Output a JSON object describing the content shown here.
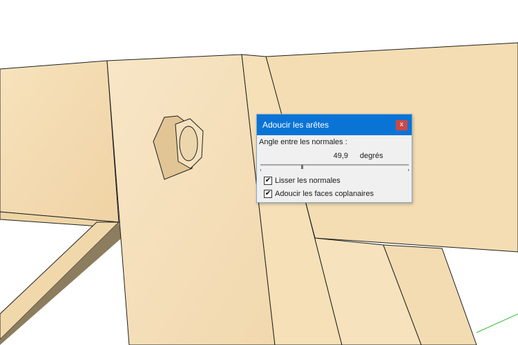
{
  "dialog": {
    "title": "Adoucir les arêtes",
    "close_label": "x",
    "angle_label": "Angle entre les normales :",
    "angle_value": "49,9",
    "angle_unit": "degrés",
    "slider_fraction": 0.28,
    "smooth_normals": {
      "label": "Lisser les normales",
      "checked": true
    },
    "soften_coplanar": {
      "label": "Adoucir les faces coplanaires",
      "checked": true
    }
  },
  "colors": {
    "titlebar": "#0a74d6",
    "close_button": "#c84a48",
    "wood": "#f3dcae",
    "axis_green": "#2ec22e"
  }
}
